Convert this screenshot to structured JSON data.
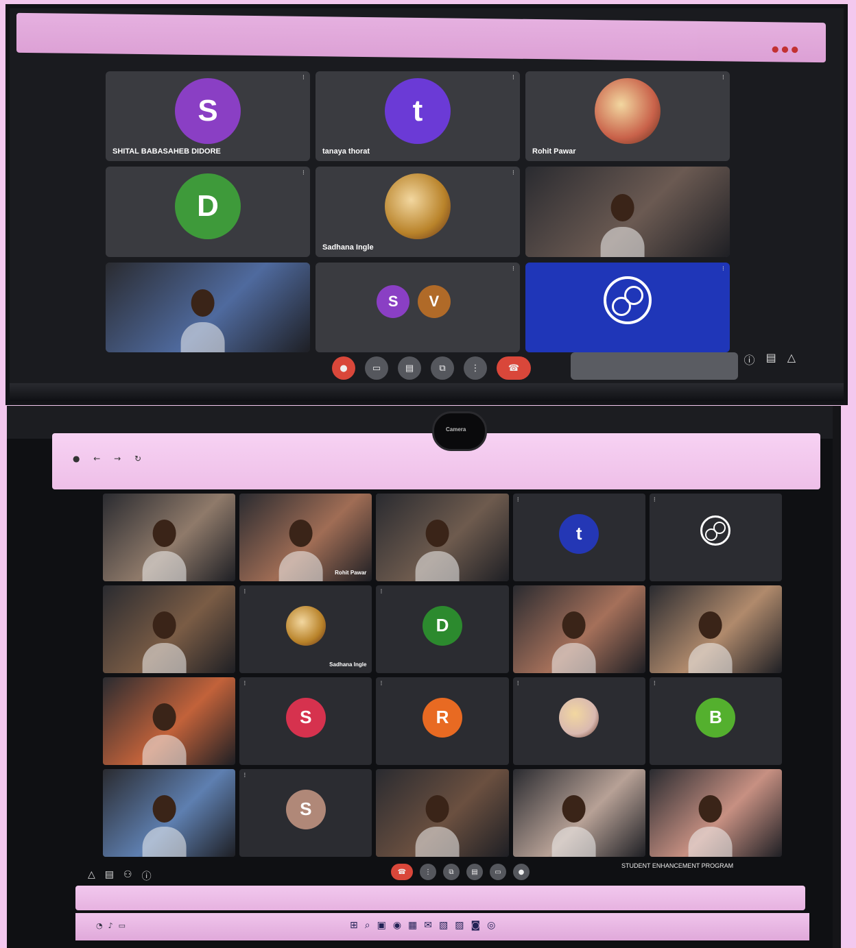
{
  "top_meeting": {
    "tiles": [
      {
        "name": "SHITAL BABASAHEB DIDORE",
        "type": "avatar",
        "initial": "S",
        "color": "#8a3fc4"
      },
      {
        "name": "tanaya thorat",
        "type": "avatar",
        "initial": "t",
        "color": "#6b3ad6"
      },
      {
        "name": "Rohit Pawar",
        "type": "photo-avatar",
        "color": "#c9624a"
      },
      {
        "name": "",
        "type": "avatar",
        "initial": "D",
        "color": "#3e9a3a"
      },
      {
        "name": "Sadhana Ingle",
        "type": "photo-avatar",
        "color": "#b9832a"
      },
      {
        "name": "",
        "type": "video",
        "color": "#6b5a52"
      },
      {
        "name": "",
        "type": "video",
        "color": "#4f6a9e"
      },
      {
        "name": "",
        "type": "group",
        "initials": [
          "S",
          "V"
        ],
        "colors": [
          "#8a3fc4",
          "#b06a28"
        ]
      },
      {
        "name": "",
        "type": "obs",
        "color": "#1f36b8"
      }
    ],
    "controls": [
      "mic-icon",
      "camera-icon",
      "captions-icon",
      "present-icon",
      "more-icon",
      "end-call-icon"
    ]
  },
  "bottom_meeting": {
    "webcam_label": "Camera",
    "meeting_info": "STUDENT ENHANCEMENT PROGRAM",
    "tiles": [
      {
        "name": "",
        "type": "video",
        "color": "#8f7a6a"
      },
      {
        "name": "Rohit Pawar",
        "type": "video",
        "color": "#a06d55"
      },
      {
        "name": "",
        "type": "video",
        "color": "#6e5b4e"
      },
      {
        "name": "",
        "type": "avatar",
        "initial": "t",
        "color": "#2437b5"
      },
      {
        "name": "",
        "type": "obs",
        "color": "#2b2c31"
      },
      {
        "name": "",
        "type": "video",
        "color": "#7a5c45"
      },
      {
        "name": "Sadhana Ingle",
        "type": "photo-avatar",
        "color": "#b9832a"
      },
      {
        "name": "",
        "type": "avatar",
        "initial": "D",
        "color": "#2c8a2e"
      },
      {
        "name": "",
        "type": "video",
        "color": "#a5705a"
      },
      {
        "name": "",
        "type": "video",
        "color": "#b08a6c"
      },
      {
        "name": "",
        "type": "video",
        "color": "#c2623a"
      },
      {
        "name": "",
        "type": "avatar",
        "initial": "S",
        "color": "#d6324e"
      },
      {
        "name": "",
        "type": "avatar",
        "initial": "R",
        "color": "#e86a22"
      },
      {
        "name": "",
        "type": "photo-avatar",
        "color": "#d9b9b0"
      },
      {
        "name": "",
        "type": "avatar",
        "initial": "B",
        "color": "#54b02e"
      },
      {
        "name": "",
        "type": "video",
        "color": "#5e7fb0"
      },
      {
        "name": "",
        "type": "avatar",
        "initial": "S",
        "color": "#b08878"
      },
      {
        "name": "",
        "type": "video",
        "color": "#6b5040"
      },
      {
        "name": "",
        "type": "video",
        "color": "#b7a196"
      },
      {
        "name": "",
        "type": "video",
        "color": "#c79082"
      }
    ],
    "controls": [
      "end-call-icon",
      "mic-icon",
      "camera-icon",
      "captions-icon",
      "present-icon",
      "more-icon"
    ]
  }
}
